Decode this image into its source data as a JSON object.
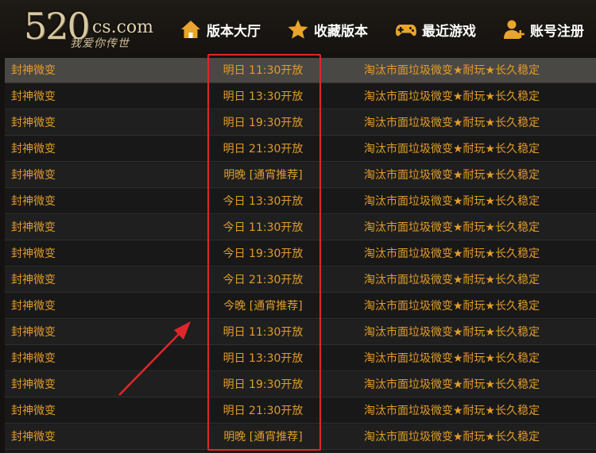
{
  "logo": {
    "number": "520",
    "domain": "cs.com",
    "tagline": "我爱你传世"
  },
  "nav": [
    {
      "label": "版本大厅",
      "icon": "home-icon"
    },
    {
      "label": "收藏版本",
      "icon": "star-icon"
    },
    {
      "label": "最近游戏",
      "icon": "gamepad-icon"
    },
    {
      "label": "账号注册",
      "icon": "add-user-icon"
    }
  ],
  "colors": {
    "accent": "#e09c2c",
    "highlight_row": "#4a4844",
    "annotation_red": "#e0262a",
    "header_bg": "#1e1a16"
  },
  "rows": [
    {
      "name": "封神微变",
      "time": "明日 11:30开放",
      "desc": "淘汰市面垃圾微变★耐玩★长久稳定"
    },
    {
      "name": "封神微变",
      "time": "明日 13:30开放",
      "desc": "淘汰市面垃圾微变★耐玩★长久稳定"
    },
    {
      "name": "封神微变",
      "time": "明日 19:30开放",
      "desc": "淘汰市面垃圾微变★耐玩★长久稳定"
    },
    {
      "name": "封神微变",
      "time": "明日 21:30开放",
      "desc": "淘汰市面垃圾微变★耐玩★长久稳定"
    },
    {
      "name": "封神微变",
      "time": "明晚 [通宵推荐]",
      "desc": "淘汰市面垃圾微变★耐玩★长久稳定"
    },
    {
      "name": "封神微变",
      "time": "今日 13:30开放",
      "desc": "淘汰市面垃圾微变★耐玩★长久稳定"
    },
    {
      "name": "封神微变",
      "time": "今日 11:30开放",
      "desc": "淘汰市面垃圾微变★耐玩★长久稳定"
    },
    {
      "name": "封神微变",
      "time": "今日 19:30开放",
      "desc": "淘汰市面垃圾微变★耐玩★长久稳定"
    },
    {
      "name": "封神微变",
      "time": "今日 21:30开放",
      "desc": "淘汰市面垃圾微变★耐玩★长久稳定"
    },
    {
      "name": "封神微变",
      "time": "今晚 [通宵推荐]",
      "desc": "淘汰市面垃圾微变★耐玩★长久稳定"
    },
    {
      "name": "封神微变",
      "time": "明日 11:30开放",
      "desc": "淘汰市面垃圾微变★耐玩★长久稳定"
    },
    {
      "name": "封神微变",
      "time": "明日 13:30开放",
      "desc": "淘汰市面垃圾微变★耐玩★长久稳定"
    },
    {
      "name": "封神微变",
      "time": "明日 19:30开放",
      "desc": "淘汰市面垃圾微变★耐玩★长久稳定"
    },
    {
      "name": "封神微变",
      "time": "明日 21:30开放",
      "desc": "淘汰市面垃圾微变★耐玩★长久稳定"
    },
    {
      "name": "封神微变",
      "time": "明晚 [通宵推荐]",
      "desc": "淘汰市面垃圾微变★耐玩★长久稳定"
    }
  ]
}
